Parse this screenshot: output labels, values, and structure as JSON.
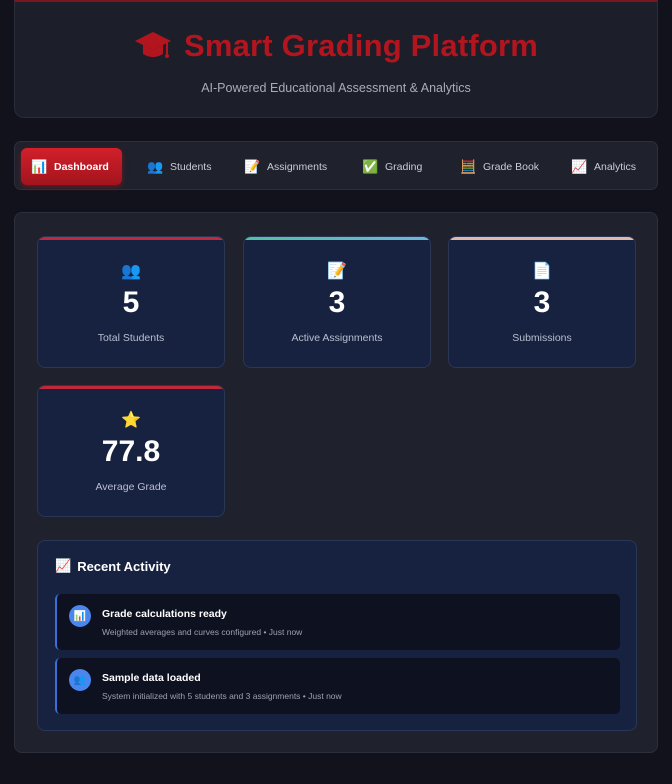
{
  "header": {
    "icon": "graduation-cap-icon",
    "title": "Smart Grading Platform",
    "subtitle": "AI-Powered Educational Assessment & Analytics",
    "title_color": "#b3151f"
  },
  "nav": {
    "items": [
      {
        "label": "Dashboard",
        "icon": "bar-chart-icon",
        "glyph": "📊",
        "active": true
      },
      {
        "label": "Students",
        "icon": "people-icon",
        "glyph": "👥"
      },
      {
        "label": "Assignments",
        "icon": "memo-icon",
        "glyph": "📝"
      },
      {
        "label": "Grading",
        "icon": "check-mark-icon",
        "glyph": "✅"
      },
      {
        "label": "Grade Book",
        "icon": "abacus-icon",
        "glyph": "🧮"
      },
      {
        "label": "Analytics",
        "icon": "trend-chart-icon",
        "glyph": "📈"
      }
    ],
    "active_color": "#c41a24"
  },
  "stats": [
    {
      "value": "5",
      "label": "Total Students",
      "icon": "people-icon",
      "glyph": "👥",
      "accent": "#c3283a"
    },
    {
      "value": "3",
      "label": "Active Assignments",
      "icon": "memo-icon",
      "glyph": "📝",
      "accent": "#4fc3a0"
    },
    {
      "value": "3",
      "label": "Submissions",
      "icon": "document-icon",
      "glyph": "📄",
      "accent": "#e0b9a8"
    },
    {
      "value": "77.8",
      "label": "Average Grade",
      "icon": "star-icon",
      "glyph": "⭐",
      "accent": "#c3283a"
    }
  ],
  "activity": {
    "title": "Recent Activity",
    "icon": "trend-chart-icon",
    "glyph": "📈",
    "items": [
      {
        "title": "Grade calculations ready",
        "meta": "Weighted averages and curves configured • Just now",
        "icon": "bar-chart-icon",
        "glyph": "📊"
      },
      {
        "title": "Sample data loaded",
        "meta": "System initialized with 5 students and 3 assignments • Just now",
        "icon": "people-icon",
        "glyph": "👥"
      }
    ]
  }
}
